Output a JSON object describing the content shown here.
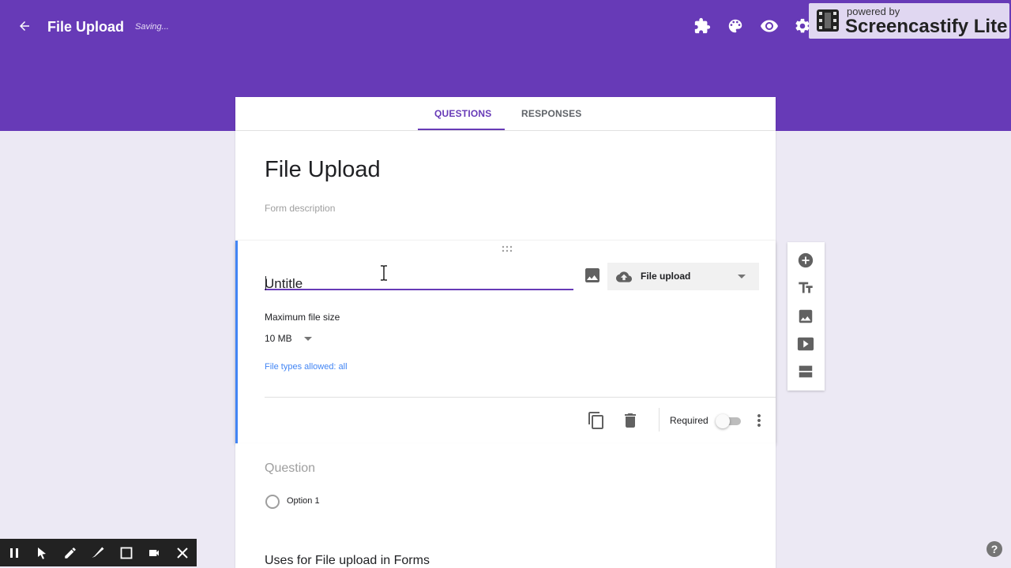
{
  "header": {
    "back_icon": "arrow-back-icon",
    "title": "File Upload",
    "status": "Saving...",
    "icons": [
      "addon-icon",
      "palette-icon",
      "preview-icon",
      "settings-icon"
    ],
    "color": "#673ab7"
  },
  "watermark": {
    "powered_by": "powered by",
    "brand": "Screencastify Lite"
  },
  "tabs": [
    {
      "label": "QUESTIONS",
      "active": true
    },
    {
      "label": "RESPONSES",
      "active": false
    }
  ],
  "form": {
    "title": "File Upload",
    "description_placeholder": "Form description"
  },
  "question": {
    "title_value": "Untitle",
    "type_label": "File upload",
    "max_size_label": "Maximum file size",
    "max_size_value": "10 MB",
    "file_types_link": "File types allowed: all",
    "required_label": "Required",
    "required": false
  },
  "next_question": {
    "title_placeholder": "Question",
    "option_label": "Option 1",
    "following_title": "Uses for File upload in Forms"
  },
  "side_toolbar": [
    "add-question-icon",
    "add-title-icon",
    "add-image-icon",
    "add-video-icon",
    "add-section-icon"
  ],
  "recorder": [
    "pause-icon",
    "pointer-icon",
    "pen-icon",
    "highlighter-icon",
    "rectangle-icon",
    "camera-icon",
    "close-icon"
  ],
  "help": "?"
}
